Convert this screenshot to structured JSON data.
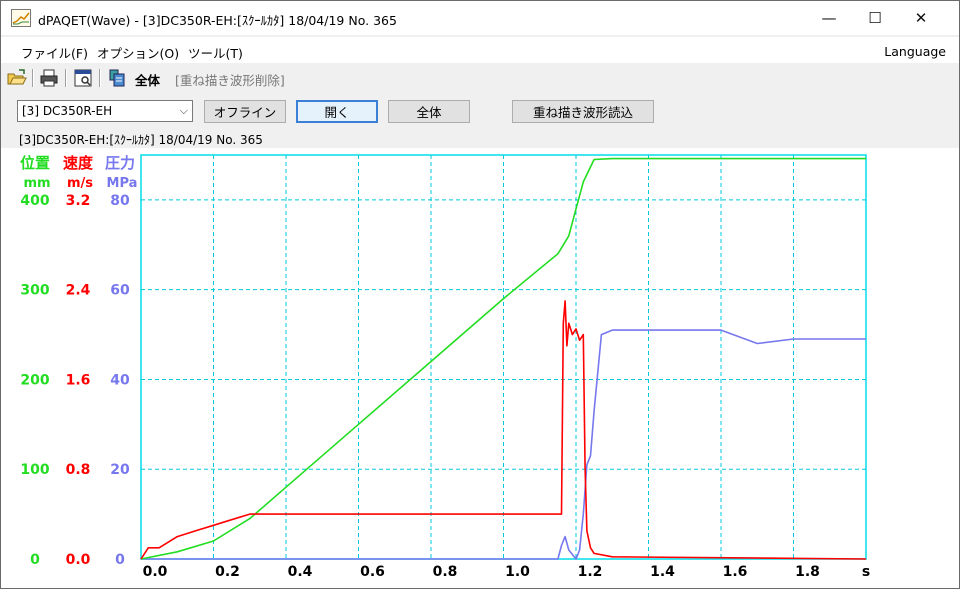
{
  "window": {
    "title": "dPAQET(Wave) - [3]DC350R-EH:[ｽｸｰﾙｶﾀ] 18/04/19 No. 365",
    "min_glyph": "—",
    "max_glyph": "☐",
    "close_glyph": "✕"
  },
  "menu": {
    "file": "ファイル(F)",
    "option": "オプション(O)",
    "tools": "ツール(T)",
    "language": "Language"
  },
  "toolbar": {
    "all_label": "全体",
    "overlay_delete_label": "[重ね描き波形削除]"
  },
  "controls": {
    "machine_select": "[3] DC350R-EH",
    "offline_button": "オフライン",
    "open_button": "開く",
    "all_button": "全体",
    "overlay_read_button": "重ね描き波形読込"
  },
  "info_line": "[3]DC350R-EH:[ｽｸｰﾙｶﾀ] 18/04/19 No. 365",
  "colors": {
    "position": "#22dd22",
    "velocity": "#ff0000",
    "pressure": "#7777ee",
    "grid": "#00c8dc",
    "frame": "#00dde8"
  },
  "chart_data": {
    "type": "line",
    "axes": {
      "position": {
        "label": "位置",
        "unit": "mm",
        "ylim": [
          0,
          450
        ],
        "ticks": [
          "0",
          "100",
          "200",
          "300",
          "400"
        ]
      },
      "velocity": {
        "label": "速度",
        "unit": "m/s",
        "ylim": [
          0,
          3.6
        ],
        "ticks": [
          "0.0",
          "0.8",
          "1.6",
          "2.4",
          "3.2"
        ]
      },
      "pressure": {
        "label": "圧力",
        "unit": "MPa",
        "ylim": [
          0,
          90
        ],
        "ticks": [
          "0",
          "20",
          "40",
          "60",
          "80"
        ]
      }
    },
    "x_unit": "s",
    "xlim": [
      0,
      2.0
    ],
    "x_ticks": [
      "0.0",
      "0.2",
      "0.4",
      "0.6",
      "0.8",
      "1.0",
      "1.2",
      "1.4",
      "1.6",
      "1.8"
    ],
    "grid": true,
    "series": [
      {
        "name": "位置",
        "x": [
          0.0,
          0.1,
          0.2,
          0.3,
          0.4,
          0.6,
          0.8,
          1.0,
          1.15,
          1.18,
          1.2,
          1.22,
          1.25,
          1.3,
          1.5,
          1.8,
          2.0
        ],
        "values": [
          0,
          8,
          20,
          45,
          80,
          150,
          220,
          290,
          340,
          360,
          390,
          420,
          445,
          446,
          446,
          446,
          446
        ]
      },
      {
        "name": "速度",
        "x": [
          0.0,
          0.02,
          0.05,
          0.1,
          0.15,
          0.2,
          0.25,
          0.3,
          0.5,
          0.8,
          1.0,
          1.15,
          1.16,
          1.165,
          1.17,
          1.175,
          1.18,
          1.19,
          1.2,
          1.21,
          1.22,
          1.225,
          1.23,
          1.24,
          1.25,
          1.3,
          2.0
        ],
        "values": [
          0.0,
          0.1,
          0.1,
          0.2,
          0.25,
          0.3,
          0.35,
          0.4,
          0.4,
          0.4,
          0.4,
          0.4,
          0.4,
          2.1,
          2.3,
          1.9,
          2.1,
          2.0,
          2.05,
          1.95,
          2.0,
          0.8,
          0.25,
          0.1,
          0.05,
          0.02,
          0.0
        ]
      },
      {
        "name": "圧力",
        "x": [
          0.0,
          0.5,
          1.0,
          1.15,
          1.16,
          1.17,
          1.18,
          1.2,
          1.21,
          1.22,
          1.23,
          1.24,
          1.25,
          1.27,
          1.3,
          1.5,
          1.6,
          1.7,
          1.8,
          2.0
        ],
        "values": [
          0,
          0,
          0,
          0,
          3,
          5,
          2,
          0,
          2,
          10,
          21,
          23,
          33,
          50,
          51,
          51,
          51,
          48,
          49,
          49
        ]
      }
    ]
  }
}
